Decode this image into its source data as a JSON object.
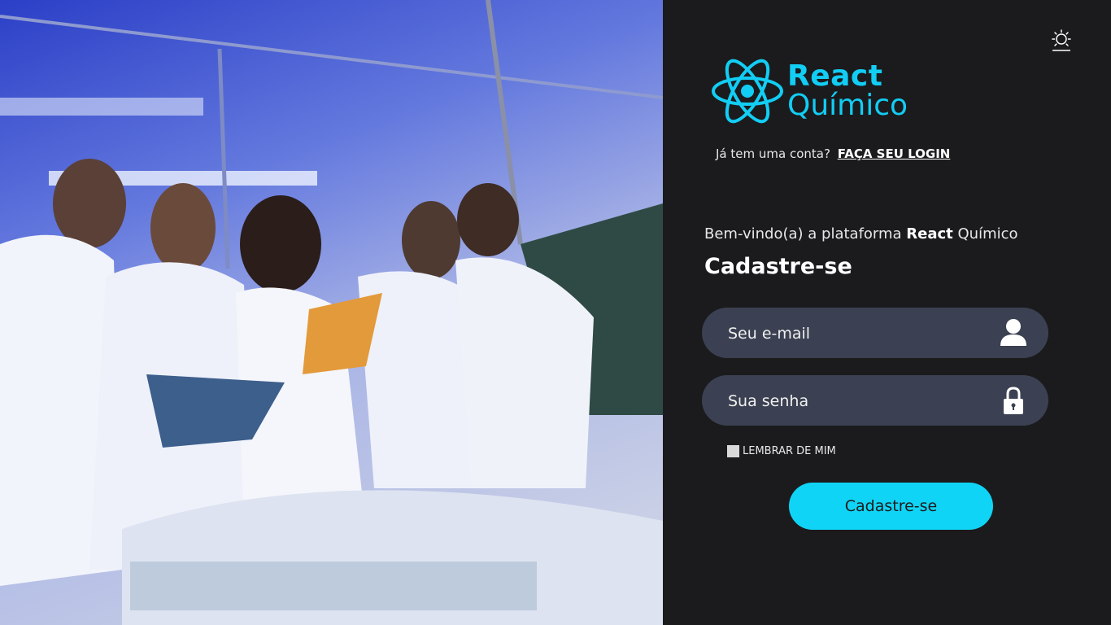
{
  "hero": {
    "image_description_icon": "students-in-lab-photo"
  },
  "theme": {
    "icon": "sun-icon"
  },
  "logo": {
    "line1": "React",
    "line2": "Químico",
    "color": "#12cdf4"
  },
  "account": {
    "prompt": "Já tem uma conta?",
    "login_link": "FAÇA SEU LOGIN"
  },
  "welcome": {
    "prefix": "Bem-vindo(a) a plataforma ",
    "brand_bold": "React",
    "suffix": " Químico"
  },
  "form": {
    "heading": "Cadastre-se",
    "email_placeholder": "Seu e-mail",
    "password_placeholder": "Sua senha",
    "remember_label": "LEMBRAR DE MIM",
    "submit_label": "Cadastre-se"
  },
  "colors": {
    "accent": "#10d4f5",
    "panel_bg": "#1b1b1d",
    "field_bg": "#3b4152"
  }
}
